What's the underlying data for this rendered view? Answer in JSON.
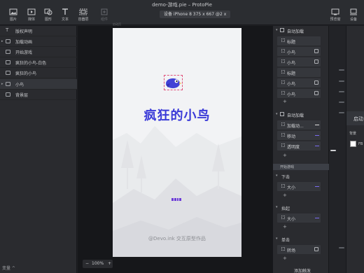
{
  "window": {
    "title": "demo-游戏.pie – ProtoPie"
  },
  "toolbar": {
    "left": [
      {
        "label": "图片",
        "icon": "image-icon"
      },
      {
        "label": "媒体",
        "icon": "media-icon"
      },
      {
        "label": "图形",
        "icon": "shape-icon"
      },
      {
        "label": "文本",
        "icon": "text-icon"
      },
      {
        "label": "容器层",
        "icon": "container-icon"
      },
      {
        "label": "组件",
        "icon": "component-icon"
      }
    ],
    "device_label": "设备   iPhone 8  375 x 667  @2 x",
    "right": [
      {
        "label": "预览窗",
        "icon": "preview-icon"
      },
      {
        "label": "设备",
        "icon": "device-icon"
      }
    ]
  },
  "layers": [
    {
      "label": "版权声明",
      "icon": "text"
    },
    {
      "label": "加载动画",
      "icon": "image",
      "caret": true
    },
    {
      "label": "开始游戏",
      "icon": "image"
    },
    {
      "label": "疯狂的小鸟-白色",
      "icon": "image"
    },
    {
      "label": "疯狂的小鸟",
      "icon": "image"
    },
    {
      "label": "小鸟",
      "icon": "image",
      "caret": true
    },
    {
      "label": "背景层",
      "icon": "image"
    }
  ],
  "variables_label": "变量",
  "canvas": {
    "artboard_label": "启动页",
    "game_title": "疯狂的小鸟",
    "credit": "@Devo.ink 交互原型作品",
    "zoom": "100%",
    "loader_segments": 4
  },
  "triggers": {
    "group1": {
      "title": "自动加载",
      "rows": [
        "标题",
        "小鸟",
        "小鸟",
        "标题",
        "小鸟",
        "小鸟"
      ]
    },
    "group2": {
      "title": "自动加载",
      "rows": [
        "加载动...",
        "移动",
        "透明度"
      ]
    },
    "start_tab": "开始游戏",
    "group3": {
      "title": "下击",
      "rows": [
        "大小"
      ]
    },
    "group4": {
      "title": "抬起",
      "rows": [
        "大小"
      ]
    },
    "group5": {
      "title": "单击",
      "rows": [
        "转场"
      ]
    },
    "add_trigger": "添加触发"
  },
  "props": {
    "header": "启动",
    "bg_label": "背景",
    "bg_hex": "FB",
    "bg_color": "#ffffff"
  },
  "colors": {
    "accent": "#7b6cf0",
    "title_blue": "#3b3bd8",
    "bird_blue": "#4242d6"
  }
}
